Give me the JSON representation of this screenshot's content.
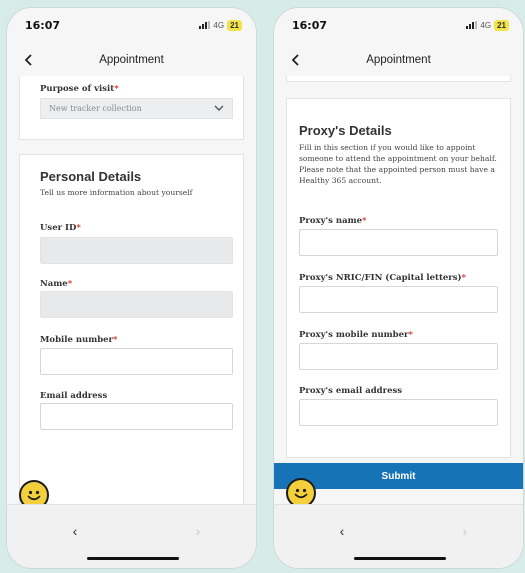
{
  "colors": {
    "background": "#d8ecea",
    "accent": "#1673b6",
    "required": "#d33333",
    "battery": "#f2e34c",
    "fab": "#f2cf3b"
  },
  "left_screen": {
    "status": {
      "time": "16:07",
      "network": "4G",
      "battery": "21"
    },
    "header": {
      "title": "Appointment",
      "back_icon": "chevron-left-icon"
    },
    "purpose": {
      "label": "Purpose of visit",
      "required_mark": "*",
      "selected": "New tracker collection",
      "icon": "chevron-down-icon"
    },
    "personal": {
      "title": "Personal Details",
      "subtitle": "Tell us more information about yourself",
      "fields": [
        {
          "label": "User ID",
          "required_mark": "*",
          "value": ""
        },
        {
          "label": "Name",
          "required_mark": "*",
          "value": ""
        },
        {
          "label": "Mobile number",
          "required_mark": "*",
          "value": ""
        },
        {
          "label": "Email address",
          "required_mark": "",
          "value": ""
        }
      ]
    },
    "nav": {
      "back": "‹",
      "forward": "›"
    }
  },
  "right_screen": {
    "status": {
      "time": "16:07",
      "network": "4G",
      "battery": "21"
    },
    "header": {
      "title": "Appointment",
      "back_icon": "chevron-left-icon"
    },
    "proxy": {
      "title": "Proxy's Details",
      "description": "Fill in this section if you would like to appoint someone to attend the appointment on your behalf. Please note that the appointed person must have a Healthy 365 account.",
      "fields": [
        {
          "label": "Proxy's name",
          "required_mark": "*",
          "value": ""
        },
        {
          "label": "Proxy's NRIC/FIN (Capital letters)",
          "required_mark": "*",
          "value": ""
        },
        {
          "label": "Proxy's mobile number",
          "required_mark": "*",
          "value": ""
        },
        {
          "label": "Proxy's email address",
          "required_mark": "",
          "value": ""
        }
      ]
    },
    "submit_label": "Submit",
    "nav": {
      "back": "‹",
      "forward": "›"
    }
  }
}
